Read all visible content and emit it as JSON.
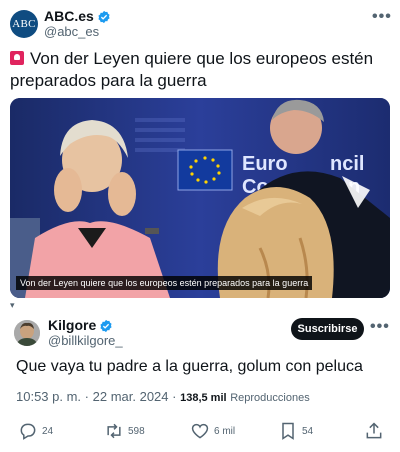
{
  "quoted_tweet": {
    "author_name": "ABC.es",
    "author_handle": "@abc_es",
    "avatar_text": "ABC",
    "text": "Von der Leyen quiere que los europeos estén preparados para la guerra",
    "media": {
      "caption": "Von der Leyen quiere que los europeos estén preparados para la guerra",
      "backdrop_text": "Euro ncil Co n"
    },
    "separator_text": "▾"
  },
  "tweet": {
    "author_name": "Kilgore",
    "author_handle": "@billkilgore_",
    "subscribe_label": "Suscribirse",
    "text": "Que vaya tu padre a la guerra, golum con peluca",
    "time": "10:53 p. m.",
    "date": "22 mar. 2024",
    "views_count": "138,5 mil",
    "views_label": "Reproducciones"
  },
  "actions": {
    "replies": "24",
    "retweets": "598",
    "likes": "6 mil",
    "bookmarks": "54"
  },
  "colors": {
    "verified": "#1d9bf0",
    "text": "#0f1419",
    "secondary": "#536471",
    "abc_blue": "#0f4c81"
  },
  "icons": [
    "verified-badge-icon",
    "more-options-icon",
    "siren-icon",
    "reply-icon",
    "retweet-icon",
    "like-icon",
    "bookmark-icon",
    "share-icon"
  ]
}
